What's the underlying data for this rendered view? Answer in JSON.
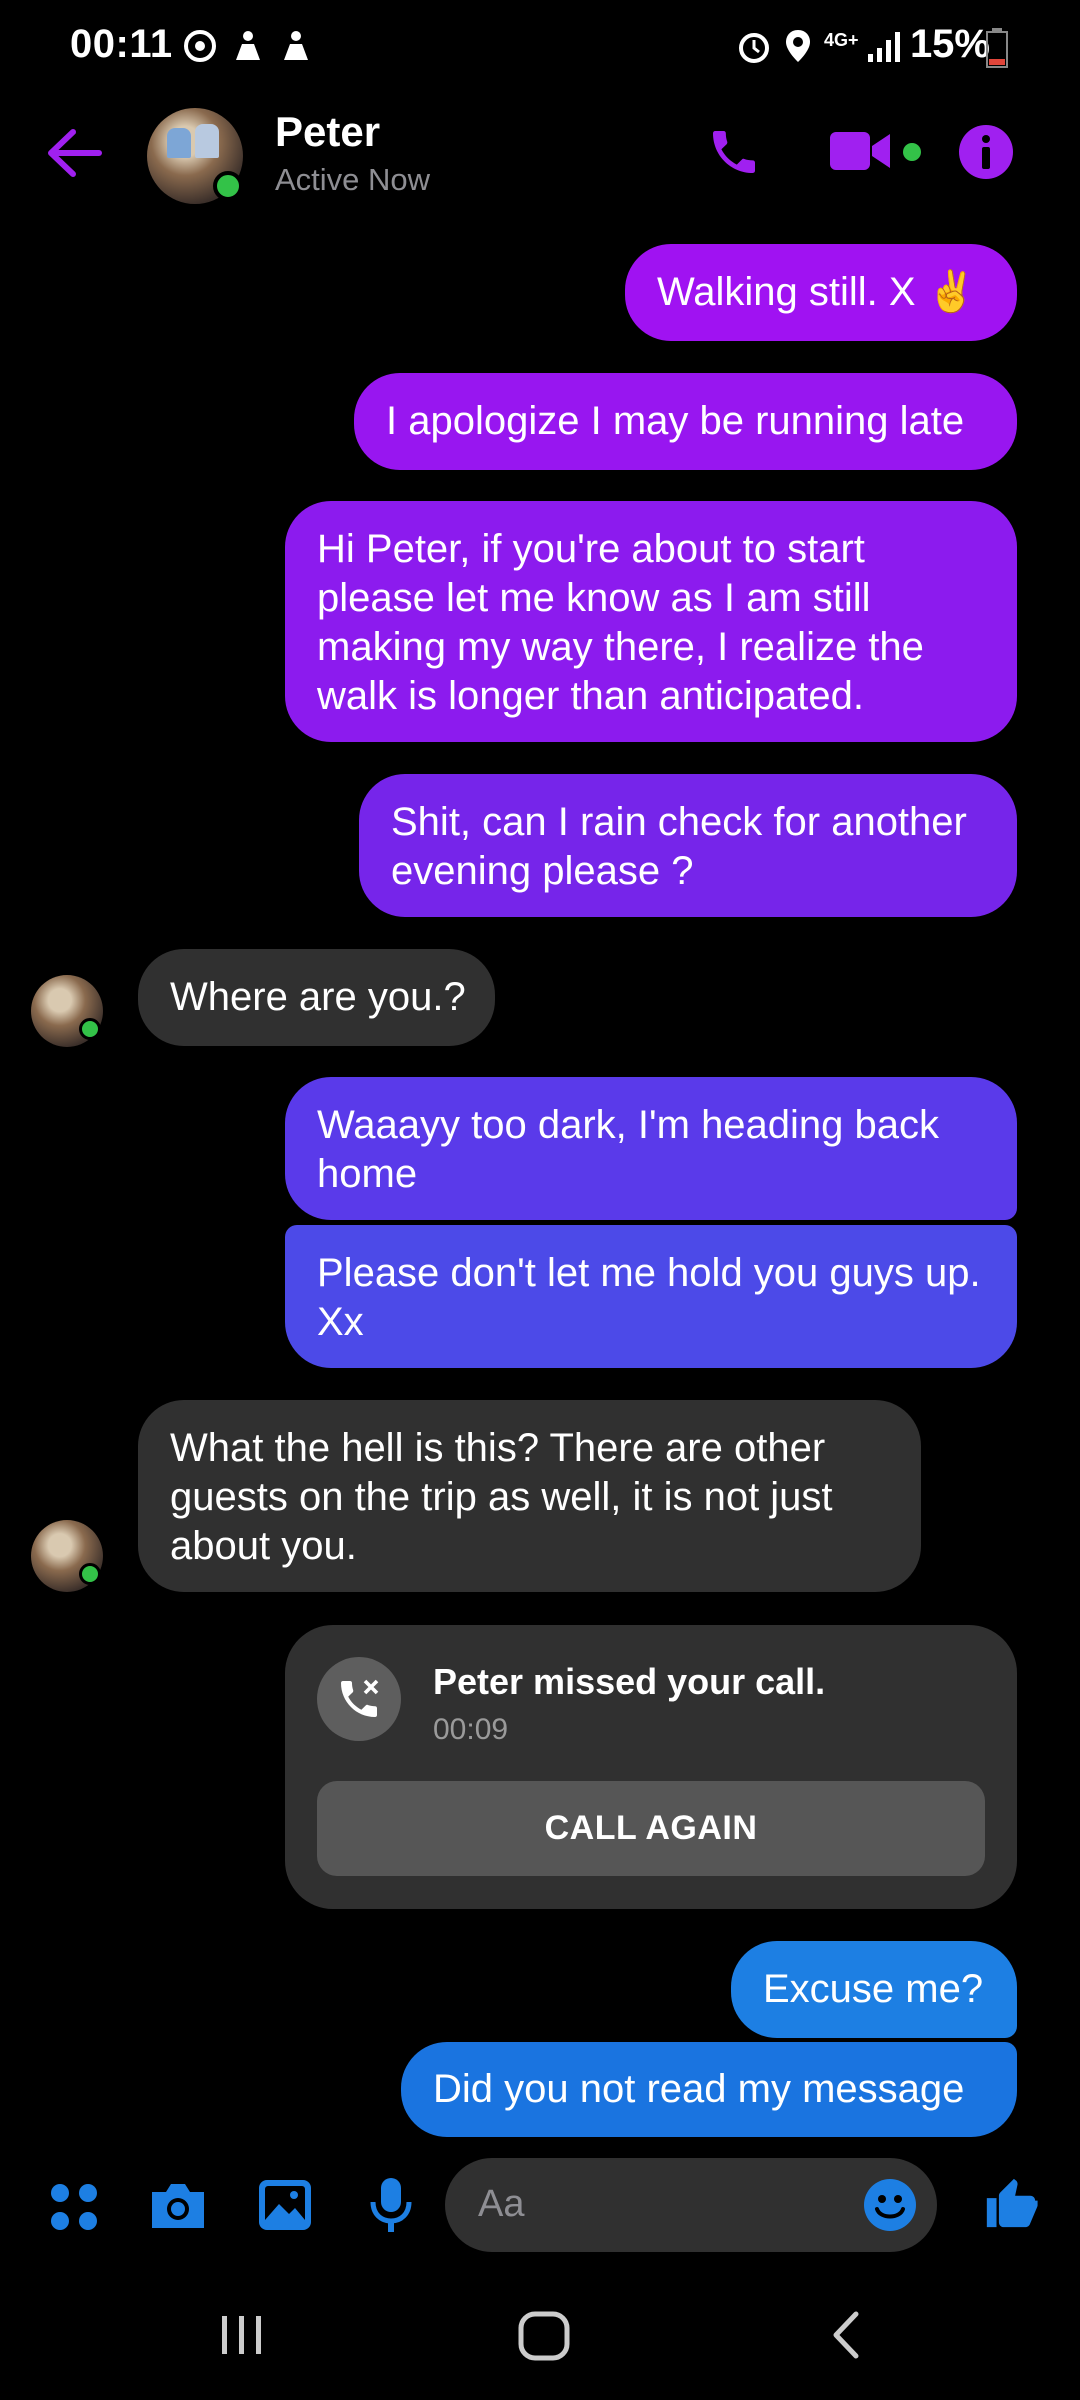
{
  "status_bar": {
    "time": "00:11",
    "network": "4G+",
    "battery": "15%"
  },
  "header": {
    "name": "Peter",
    "status": "Active Now",
    "accent": "#a020f0"
  },
  "messages": [
    {
      "from": "me",
      "text": "Walking still. X ✌️"
    },
    {
      "from": "me",
      "text": "I apologize I may be running late"
    },
    {
      "from": "me",
      "text": "Hi Peter, if you're about to start please let me know as I am still making my way there, I realize the walk is longer than anticipated."
    },
    {
      "from": "me",
      "text": "Shit, can I rain check for another evening please ?"
    },
    {
      "from": "them",
      "text": "Where are you.?"
    },
    {
      "from": "me",
      "text": "Waaayy too dark, I'm heading back home"
    },
    {
      "from": "me",
      "text": "Please don't let me hold you guys up. Xx"
    },
    {
      "from": "them",
      "text": "What the hell is this? There are other guests on the trip as well, it is not just about you."
    },
    {
      "from": "me",
      "text": "Excuse me?"
    },
    {
      "from": "me",
      "text": "Did you not read my message"
    }
  ],
  "missed_call": {
    "title": "Peter missed your call.",
    "time": "00:09",
    "button": "CALL AGAIN"
  },
  "composer": {
    "placeholder": "Aa",
    "icons": [
      "apps-icon",
      "camera-icon",
      "gallery-icon",
      "microphone-icon",
      "emoji-icon",
      "thumbs-up-icon"
    ],
    "color": "#1d7fe3"
  }
}
